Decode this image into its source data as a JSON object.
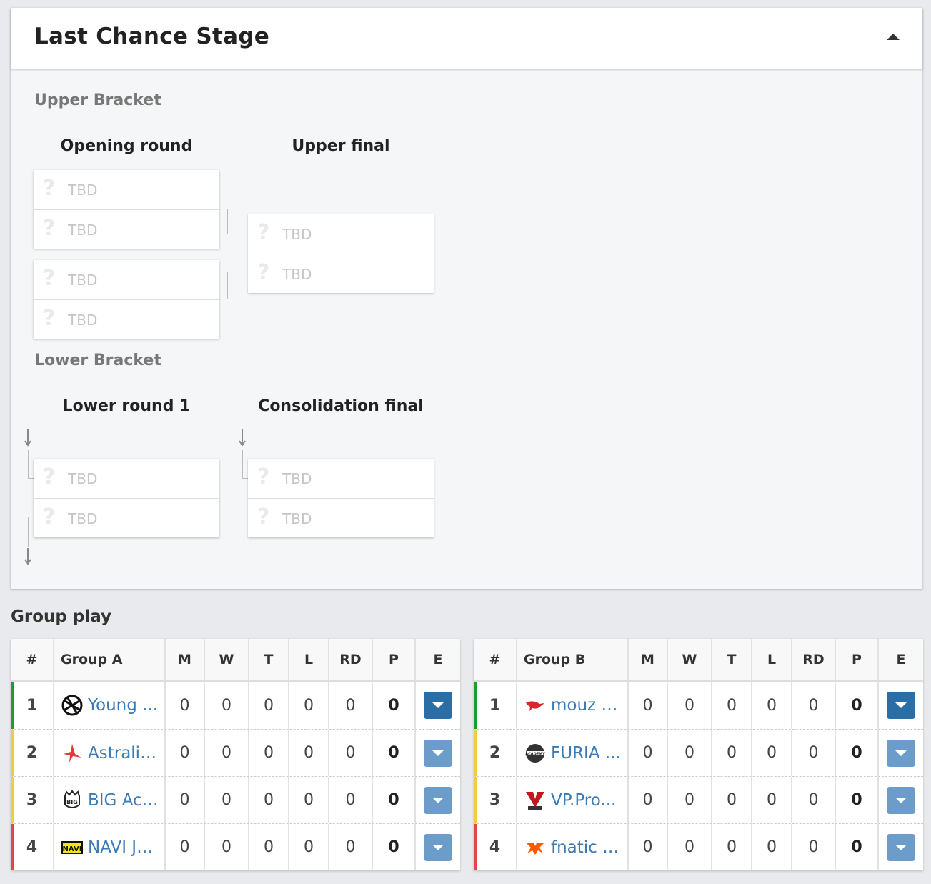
{
  "panel": {
    "title": "Last Chance Stage",
    "upper_bracket": {
      "title": "Upper Bracket",
      "rounds": [
        "Opening round",
        "Upper final"
      ]
    },
    "lower_bracket": {
      "title": "Lower Bracket",
      "rounds": [
        "Lower round 1",
        "Consolidation final"
      ]
    },
    "slot_label": "TBD",
    "slot_icon": "?"
  },
  "group_play": {
    "title": "Group play",
    "columns": [
      "#",
      "M",
      "W",
      "T",
      "L",
      "RD",
      "P",
      "E"
    ],
    "colors": {
      "qualified": "#1a9e2e",
      "mid": "#f0cd3c",
      "eliminated": "#e0474c",
      "button_active": "#2b6ea6",
      "button": "#6c9dca"
    },
    "groups": [
      {
        "name": "Group A",
        "rows": [
          {
            "rank": "1",
            "team": "Young Ninjas",
            "display": "Young ...",
            "logo": "ninjas-logo",
            "M": "0",
            "W": "0",
            "T": "0",
            "L": "0",
            "RD": "0",
            "P": "0"
          },
          {
            "rank": "2",
            "team": "Astralis Talent",
            "display": "Astralis...",
            "logo": "astralis-logo",
            "M": "0",
            "W": "0",
            "T": "0",
            "L": "0",
            "RD": "0",
            "P": "0"
          },
          {
            "rank": "3",
            "team": "BIG Academy",
            "display": "BIG Aca...",
            "logo": "big-logo",
            "M": "0",
            "W": "0",
            "T": "0",
            "L": "0",
            "RD": "0",
            "P": "0"
          },
          {
            "rank": "4",
            "team": "NAVI Junior",
            "display": "NAVI Ju...",
            "logo": "navi-logo",
            "M": "0",
            "W": "0",
            "T": "0",
            "L": "0",
            "RD": "0",
            "P": "0"
          }
        ]
      },
      {
        "name": "Group B",
        "rows": [
          {
            "rank": "1",
            "team": "mouz NXT",
            "display": "mouz N...",
            "logo": "mouz-logo",
            "M": "0",
            "W": "0",
            "T": "0",
            "L": "0",
            "RD": "0",
            "P": "0"
          },
          {
            "rank": "2",
            "team": "FURIA Academy",
            "display": "FURIA ...",
            "logo": "furia-logo",
            "M": "0",
            "W": "0",
            "T": "0",
            "L": "0",
            "RD": "0",
            "P": "0"
          },
          {
            "rank": "3",
            "team": "VP.Prodigy",
            "display": "VP.Pro...",
            "logo": "vp-logo",
            "M": "0",
            "W": "0",
            "T": "0",
            "L": "0",
            "RD": "0",
            "P": "0"
          },
          {
            "rank": "4",
            "team": "fnatic Rising",
            "display": "fnatic R...",
            "logo": "fnatic-logo",
            "M": "0",
            "W": "0",
            "T": "0",
            "L": "0",
            "RD": "0",
            "P": "0"
          }
        ]
      }
    ]
  }
}
